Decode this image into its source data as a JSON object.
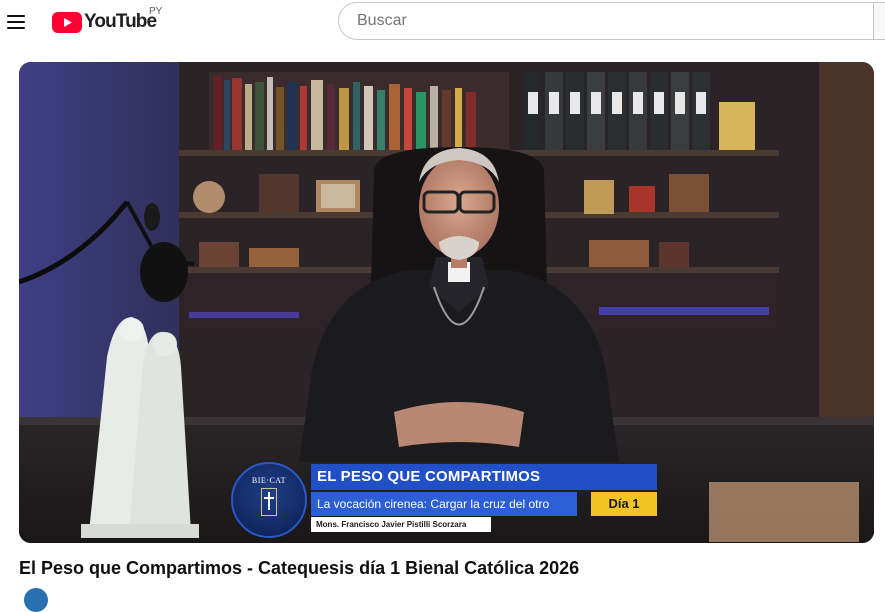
{
  "header": {
    "logo_text": "YouTube",
    "country_code": "PY",
    "search_placeholder": "Buscar",
    "search_value": ""
  },
  "video": {
    "overlay_title": "EL PESO QUE COMPARTIMOS",
    "overlay_subtitle": "La vocación cirenea: Cargar la cruz del otro",
    "overlay_day": "Día 1",
    "overlay_speaker": "Mons. Francisco Javier Pistilli Scorzara",
    "overlay_badge": "BIE·CAT",
    "title": "El Peso que Compartimos - Catequesis día 1 Bienal Católica 2026"
  },
  "colors": {
    "youtube_red": "#ff0033",
    "overlay_blue": "#2150c6",
    "overlay_yellow": "#f2c423"
  }
}
